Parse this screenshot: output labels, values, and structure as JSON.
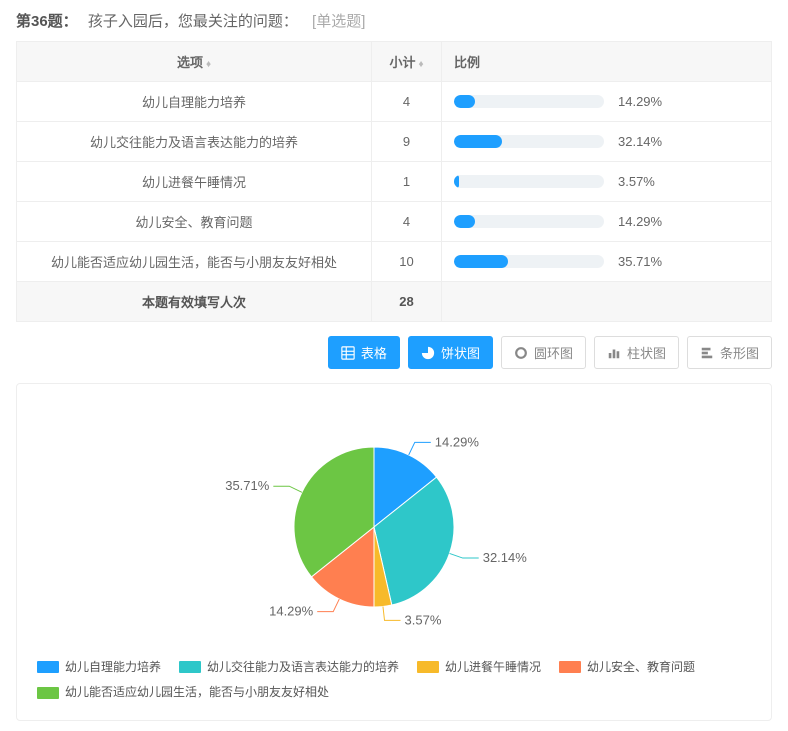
{
  "question": {
    "number": "第36题：",
    "text": "孩子入园后，您最关注的问题：",
    "type": "[单选题]"
  },
  "table": {
    "headers": {
      "option": "选项",
      "count": "小计",
      "ratio": "比例"
    },
    "rows": [
      {
        "option": "幼儿自理能力培养",
        "count": 4,
        "pct": "14.29%",
        "width": 14.29
      },
      {
        "option": "幼儿交往能力及语言表达能力的培养",
        "count": 9,
        "pct": "32.14%",
        "width": 32.14
      },
      {
        "option": "幼儿进餐午睡情况",
        "count": 1,
        "pct": "3.57%",
        "width": 3.57
      },
      {
        "option": "幼儿安全、教育问题",
        "count": 4,
        "pct": "14.29%",
        "width": 14.29
      },
      {
        "option": "幼儿能否适应幼儿园生活，能否与小朋友友好相处",
        "count": 10,
        "pct": "35.71%",
        "width": 35.71
      }
    ],
    "total": {
      "label": "本题有效填写人次",
      "count": 28
    }
  },
  "buttons": {
    "table": "表格",
    "pie": "饼状图",
    "donut": "圆环图",
    "bar": "柱状图",
    "hbar": "条形图"
  },
  "chart_data": {
    "type": "pie",
    "title": "",
    "series": [
      {
        "name": "幼儿自理能力培养",
        "value": 14.29,
        "color": "#1e9fff",
        "label": "14.29%"
      },
      {
        "name": "幼儿交往能力及语言表达能力的培养",
        "value": 32.14,
        "color": "#2ec7c9",
        "label": "32.14%"
      },
      {
        "name": "幼儿进餐午睡情况",
        "value": 3.57,
        "color": "#f7ba2a",
        "label": "3.57%"
      },
      {
        "name": "幼儿安全、教育问题",
        "value": 14.29,
        "color": "#ff7f50",
        "label": "14.29%"
      },
      {
        "name": "幼儿能否适应幼儿园生活，能否与小朋友友好相处",
        "value": 35.71,
        "color": "#6cc644",
        "label": "35.71%"
      }
    ]
  }
}
